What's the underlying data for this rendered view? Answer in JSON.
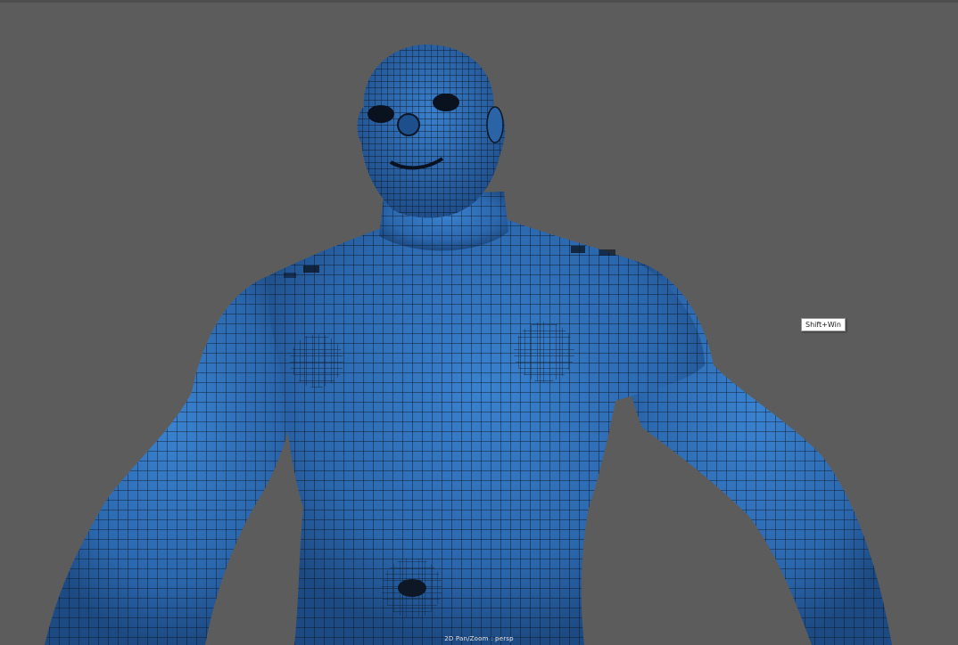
{
  "viewport": {
    "background_color": "#5c5c5c",
    "mesh_fill_color": "#2f6fb8",
    "mesh_wire_color": "#0d1726",
    "mesh_shading_color": "#173f73"
  },
  "tooltip": {
    "text": "Shift+Win"
  },
  "status": {
    "mode_label": "2D Pan/Zoom : persp"
  }
}
